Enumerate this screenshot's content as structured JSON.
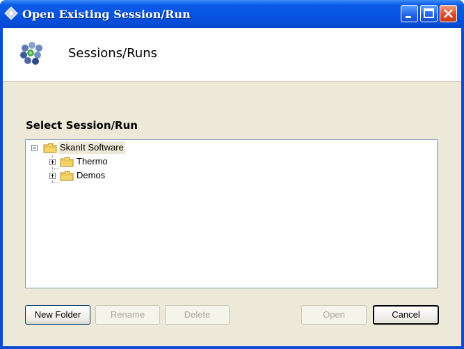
{
  "window": {
    "title": "Open Existing Session/Run"
  },
  "header": {
    "title": "Sessions/Runs"
  },
  "section_label": "Select Session/Run",
  "tree": {
    "root": {
      "label": "SkanIt Software",
      "expanded": true
    },
    "children": [
      {
        "label": "Thermo",
        "expanded": false
      },
      {
        "label": "Demos",
        "expanded": false
      }
    ]
  },
  "buttons": {
    "new_folder": "New Folder",
    "rename": "Rename",
    "delete": "Delete",
    "open": "Open",
    "cancel": "Cancel"
  },
  "colors": {
    "titlebar": "#0653e0",
    "dialog_bg": "#ece9d8",
    "folder": "#f5d46a"
  }
}
